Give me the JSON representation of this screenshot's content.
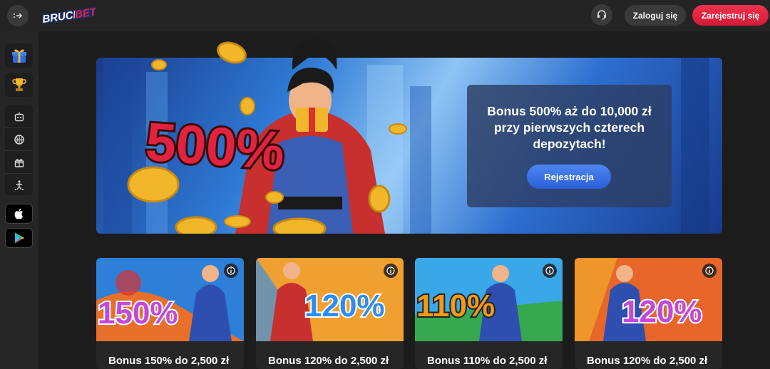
{
  "header": {
    "logo_text": "BRUCEBET",
    "login_label": "Zaloguj się",
    "register_label": "Zarejestruj się",
    "icons": [
      "sidebar-toggle-icon",
      "headset-icon"
    ]
  },
  "sidebar": {
    "promo_tiles": [
      "gift-box-icon",
      "trophy-icon"
    ],
    "nav_icons": [
      "robot-icon",
      "basketball-icon",
      "gift-icon",
      "acrobat-icon"
    ],
    "app_buttons": [
      "apple-icon",
      "google-play-icon"
    ]
  },
  "hero": {
    "badge_text": "500%",
    "title": "Bonus 500% aż do 10,000 zł przy pierwszych czterech depozytach!",
    "cta_label": "Rejestracja"
  },
  "bonuses": [
    {
      "badge": "150%",
      "title": "Bonus 150% do 2,500 zł"
    },
    {
      "badge": "120%",
      "title": "Bonus 120% do 2,500 zł"
    },
    {
      "badge": "110%",
      "title": "Bonus 110% do 2,500 zł"
    },
    {
      "badge": "120%",
      "title": "Bonus 120% do 2,500 zł"
    }
  ],
  "colors": {
    "accent_red": "#e0243f",
    "accent_blue": "#3a6fe6",
    "background": "#1c1c1c"
  }
}
